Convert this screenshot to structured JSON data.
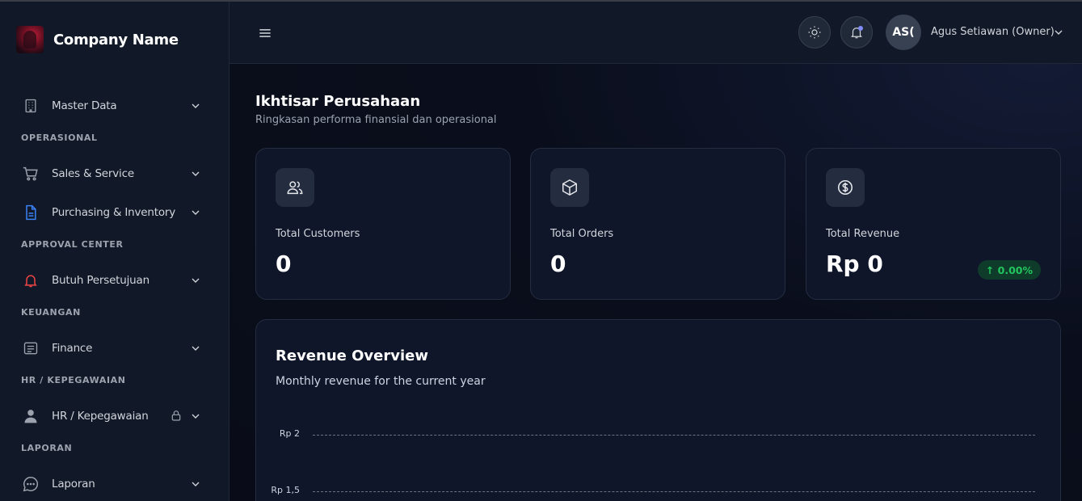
{
  "brand": {
    "name": "Company Name"
  },
  "sidebar": {
    "items": [
      {
        "label": "Master Data",
        "icon": "building-icon"
      },
      {
        "section": "OPERASIONAL"
      },
      {
        "label": "Sales & Service",
        "icon": "cart-icon"
      },
      {
        "label": "Purchasing & Inventory",
        "icon": "document-icon",
        "icon_color": "#3b82f6"
      },
      {
        "section": "APPROVAL CENTER"
      },
      {
        "label": "Butuh Persetujuan",
        "icon": "bell-icon",
        "icon_color": "#ef4444"
      },
      {
        "section": "KEUANGAN"
      },
      {
        "label": "Finance",
        "icon": "list-icon"
      },
      {
        "section": "HR / KEPEGAWAIAN"
      },
      {
        "label": "HR / Kepegawaian",
        "icon": "user-icon",
        "locked": true
      },
      {
        "section": "LAPORAN"
      },
      {
        "label": "Laporan",
        "icon": "chat-icon"
      }
    ]
  },
  "header": {
    "avatar_initials": "AS(",
    "user_name": "Agus Setiawan (Owner)"
  },
  "page": {
    "title": "Ikhtisar Perusahaan",
    "subtitle": "Ringkasan performa finansial dan operasional"
  },
  "stats": [
    {
      "label": "Total Customers",
      "value": "0",
      "icon": "users-icon"
    },
    {
      "label": "Total Orders",
      "value": "0",
      "icon": "box-icon"
    },
    {
      "label": "Total Revenue",
      "value": "Rp 0",
      "icon": "dollar-icon",
      "badge": "↑ 0.00%"
    }
  ],
  "colors": {
    "accent": "#818cf8",
    "positive": "#22c55e",
    "background": "#0b0f1e"
  },
  "chart_data": {
    "type": "line",
    "title": "Revenue Overview",
    "subtitle": "Monthly revenue for the current year",
    "y_ticks": [
      "Rp 2",
      "Rp 1,5"
    ],
    "grid": true
  }
}
